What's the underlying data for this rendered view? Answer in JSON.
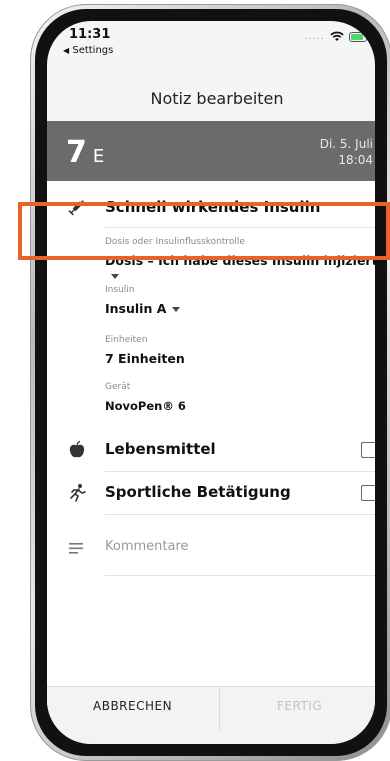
{
  "status_bar": {
    "time": "11:31",
    "back_label": "Settings",
    "signal_dots": "....."
  },
  "header": {
    "title": "Notiz bearbeiten"
  },
  "reading": {
    "value": "7",
    "unit": "E",
    "date": "Di. 5. Juli",
    "time": "18:04"
  },
  "insulin_section": {
    "title": "Schnell wirkendes Insulin",
    "icon": "syringe-icon",
    "dose_type_label": "Dosis oder Insulinflusskontrolle",
    "dose_type_value": "Dosis – Ich habe dieses Insulin injiziert",
    "insulin_label": "Insulin",
    "insulin_value": "Insulin A",
    "units_label": "Einheiten",
    "units_value": "7 Einheiten",
    "device_label": "Gerät",
    "device_value": "NovoPen® 6"
  },
  "food_section": {
    "title": "Lebensmittel",
    "icon": "apple-icon",
    "checked": false
  },
  "sport_section": {
    "title": "Sportliche Betätigung",
    "icon": "runner-icon",
    "checked": false
  },
  "comments": {
    "placeholder": "Kommentare",
    "icon": "notes-icon"
  },
  "actions": {
    "cancel": "ABBRECHEN",
    "done": "FERTIG"
  },
  "colors": {
    "band": "#6b6b6b",
    "highlight": "#e8632a",
    "battery": "#4cd964",
    "disabled_text": "#c2c2c2"
  }
}
